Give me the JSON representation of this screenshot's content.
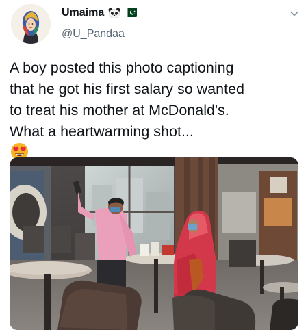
{
  "user": {
    "display_name": "Umaima",
    "handle": "@U_Pandaa",
    "name_emojis": [
      "panda-face-emoji",
      "pakistan-flag-emoji"
    ]
  },
  "tweet": {
    "lines": [
      "A boy posted this photo captioning",
      "that he got his first salary so wanted",
      "to treat his mother at McDonald's.",
      "What a heartwarming shot..."
    ],
    "trailing_emojis": [
      "heart-eyes-emoji",
      "heart-eyes-emoji",
      "heart-eyes-emoji"
    ]
  },
  "colors": {
    "text": "#0f1419",
    "secondary_text": "#536471",
    "emoji_yellow": "#f7b526",
    "heart_red": "#e8283a"
  },
  "photo": {
    "subject": "restaurant-photo"
  },
  "icons": {
    "menu": "chevron-down-icon"
  }
}
